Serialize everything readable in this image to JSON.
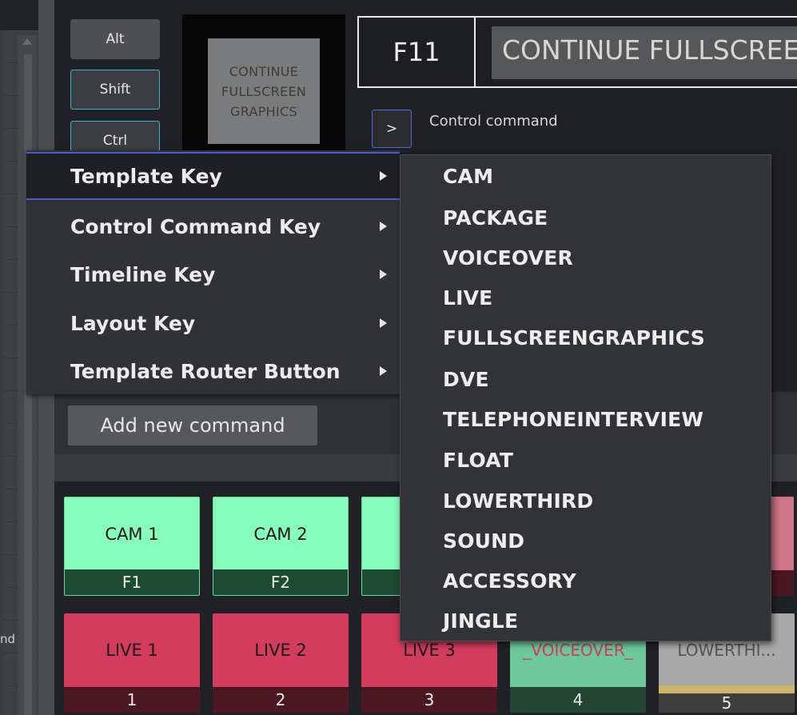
{
  "left_panel": {
    "partial_label": "nd"
  },
  "modifiers": {
    "alt": "Alt",
    "shift": "Shift",
    "ctrl": "Ctrl"
  },
  "preview": {
    "text": "CONTINUE FULLSCREEN GRAPHICS"
  },
  "key_editor": {
    "fkey": "F11",
    "name": "CONTINUE FULLSCREE",
    "expand_glyph": ">",
    "control_command_label": "Control command"
  },
  "add_command_label": "Add new command",
  "context_menu": {
    "items": [
      {
        "label": "Template Key",
        "active": true
      },
      {
        "label": "Control Command Key"
      },
      {
        "label": "Timeline Key"
      },
      {
        "label": "Layout Key"
      },
      {
        "label": "Template Router Button"
      }
    ],
    "submenu": [
      "CAM",
      "PACKAGE",
      "VOICEOVER",
      "LIVE",
      "FULLSCREENGRAPHICS",
      "DVE",
      "TELEPHONEINTERVIEW",
      "FLOAT",
      "LOWERTHIRD",
      "SOUND",
      "ACCESSORY",
      "JINGLE"
    ]
  },
  "grid": {
    "row1": [
      {
        "name": "CAM 1",
        "key": "F1"
      },
      {
        "name": "CAM 2",
        "key": "F2"
      },
      {
        "name": "",
        "key": ""
      },
      {
        "name": "",
        "key": ""
      }
    ],
    "row2": [
      {
        "name": "LIVE 1",
        "key": "1"
      },
      {
        "name": "LIVE 2",
        "key": "2"
      },
      {
        "name": "LIVE 3",
        "key": "3"
      },
      {
        "name": "_VOICEOVER_",
        "key": "4"
      },
      {
        "name": "LOWERTHI...",
        "key": "5"
      }
    ]
  },
  "colors": {
    "cam_green": "#86fdbb",
    "live_red": "#d43c5e",
    "menu_accent": "#4a5bd0",
    "modifier_outline": "#3fb7c2"
  }
}
